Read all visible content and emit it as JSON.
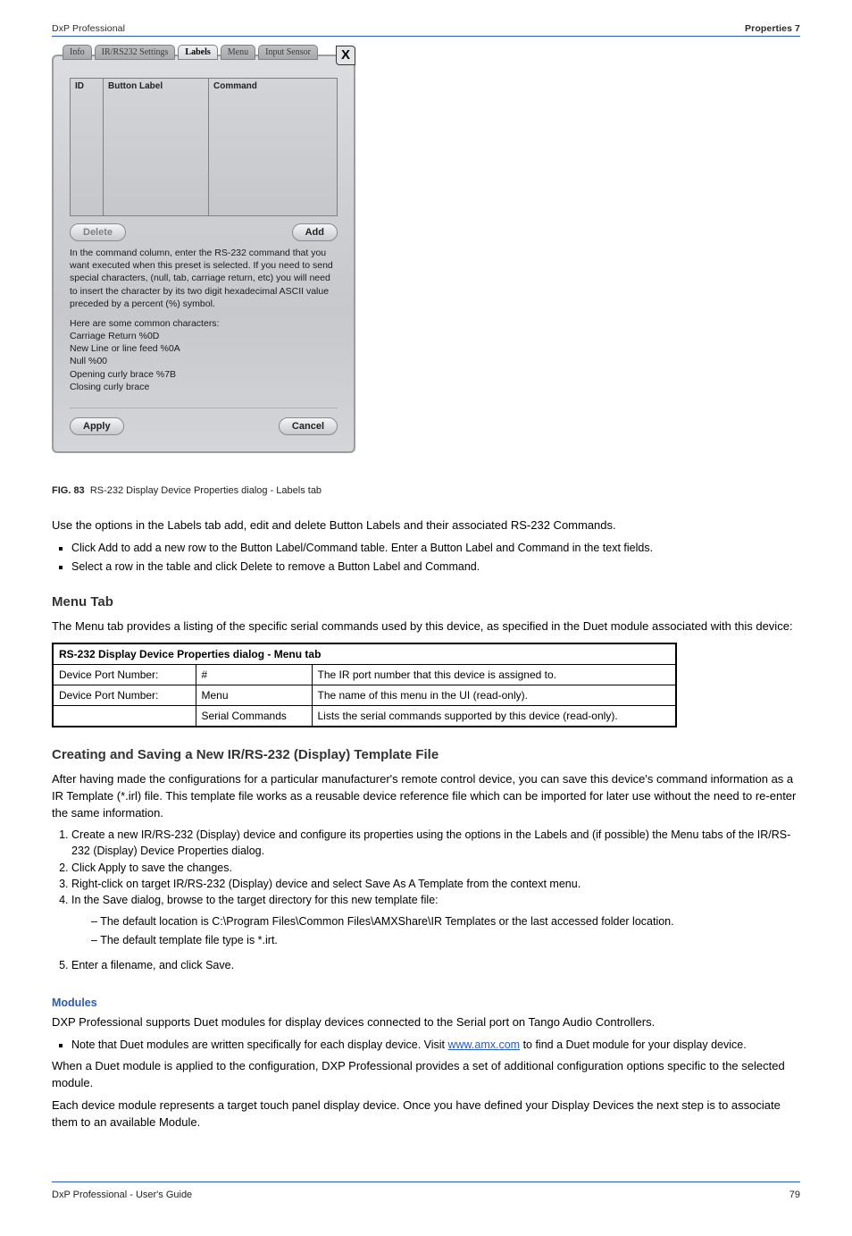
{
  "header": {
    "left": "DxP Professional",
    "right": "Properties 7"
  },
  "dialog": {
    "tabs": [
      "Info",
      "IR/RS232 Settings",
      "Labels",
      "Menu",
      "Input Sensor"
    ],
    "activeTab": "Labels",
    "close": "X",
    "columns": {
      "id": "ID",
      "button": "Button Label",
      "command": "Command"
    },
    "delete": "Delete",
    "add": "Add",
    "help": "In the command column, enter the RS-232 command that you want executed when this preset is selected.  If you need to send special characters, (null, tab, carriage return, etc) you will need to insert the character by its two digit hexadecimal ASCII value preceded by a percent (%) symbol.",
    "charsHeading": "Here are some common characters:",
    "char1": "Carriage Return %0D",
    "char2": "New Line or line feed %0A",
    "char3": "Null %00",
    "char4": "Opening curly brace %7B",
    "char5": "Closing curly brace",
    "apply": "Apply",
    "cancel": "Cancel"
  },
  "fignum": "FIG. 83",
  "figtitle": "RS-232 Display Device Properties dialog - Labels tab",
  "afterFig": {
    "p1": "Use the options in the Labels tab add, edit and delete Button Labels and their associated RS-232 Commands.",
    "bullet1a": "Click ",
    "bullet1b": "Add",
    " ...": " to add a new row to the Button Label/Command table. Enter a Button Label and Command in the text fields.",
    "bullet2a": "Select a row in the table and click ",
    "bullet2b": "Delete",
    " ...2": " to remove a Button Label and Command.",
    "bullet1_full": "Click Add to add a new row to the Button Label/Command table. Enter a Button Label and Command in the text fields.",
    "bullet2_full": "Select a row in the table and click Delete to remove a Button Label and Command."
  },
  "menuTab": {
    "heading": "Menu Tab",
    "p": "The Menu tab provides a listing of the specific serial commands used by this device, as specified in the Duet module associated with this device:"
  },
  "table": {
    "caption": "RS-232 Display Device Properties dialog - Menu tab",
    "rows": [
      {
        "c1": "Device Port Number:",
        "c2": "#",
        "c3": "The IR port number that this device is assigned to."
      },
      {
        "c1": "Device Port Number:",
        "c2": "Menu",
        "c3": "The name of this menu in the UI (read-only)."
      },
      {
        "c1": "",
        "c2": "Serial Commands",
        "c3": "Lists the serial commands supported by this device (read-only)."
      }
    ]
  },
  "modules": {
    "heading": "Creating and Saving a New IR/RS-232 (Display) Template File",
    "p1": "After having made the configurations for a particular manufacturer's remote control device, you can save this device's command information as a IR Template (*.irl) file. This template file works as a reusable device reference file which can be imported for later use without the need to re-enter the same information.",
    "step1": "Create a new IR/RS-232 (Display) device and configure its properties using the options in the Labels and (if possible) the Menu tabs of the IR/RS-232 (Display) Device Properties dialog.",
    "step2": "Click Apply to save the changes.",
    "step3": "Right-click on target IR/RS-232 (Display) device and select Save As A Template from the context menu.",
    "step4": "In the Save dialog, browse to the target directory for this new template file:",
    "step4a": "The default location is C:\\Program Files\\Common Files\\AMXShare\\IR Templates or the last accessed folder location.",
    "step4b": "The default template file type is *.irt.",
    "step5": "Enter a filename, and click Save."
  },
  "modsHead": "Modules",
  "modsIntro": "DXP Professional supports Duet modules for display devices connected to the Serial port on Tango Audio Controllers.",
  "modsNote": "Note that Duet modules are written specifically for each display device. Visit ",
  "modsLink": "www.amx.com",
  "modsNote2": " to find a Duet module for your display device.",
  "modsP2": "When a Duet module is applied to the configuration, DXP Professional provides a set of additional configuration options specific to the selected module.",
  "modsP3": "Each device module represents a target touch panel display device. Once you have defined your Display Devices the next step is to associate them to an available Module.",
  "footer": {
    "left": "DxP Professional - User's Guide",
    "right": "79"
  }
}
